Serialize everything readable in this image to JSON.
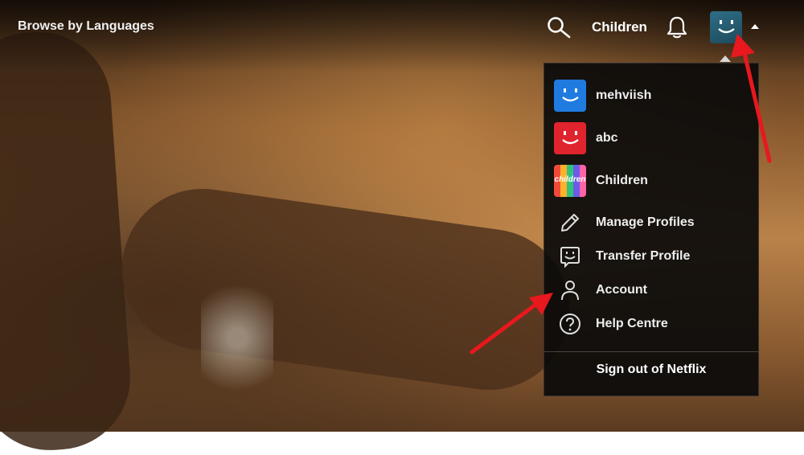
{
  "nav": {
    "left_link": "Browse by Languages",
    "profile_name": "Children",
    "search_icon": "search-icon",
    "notifications_icon": "bell-icon",
    "caret_icon": "caret-up-icon"
  },
  "menu": {
    "profiles": [
      {
        "name": "mehviish",
        "avatar_color": "#1f7be0"
      },
      {
        "name": "abc",
        "avatar_color": "#e0242d"
      },
      {
        "name": "Children",
        "avatar_badge": "children"
      }
    ],
    "actions": [
      {
        "label": "Manage Profiles",
        "icon": "pencil-icon"
      },
      {
        "label": "Transfer Profile",
        "icon": "transfer-profile-icon"
      },
      {
        "label": "Account",
        "icon": "person-icon"
      },
      {
        "label": "Help Centre",
        "icon": "help-icon"
      }
    ],
    "sign_out": "Sign out of Netflix"
  },
  "annotations": {
    "arrow_color": "#e8181e"
  }
}
